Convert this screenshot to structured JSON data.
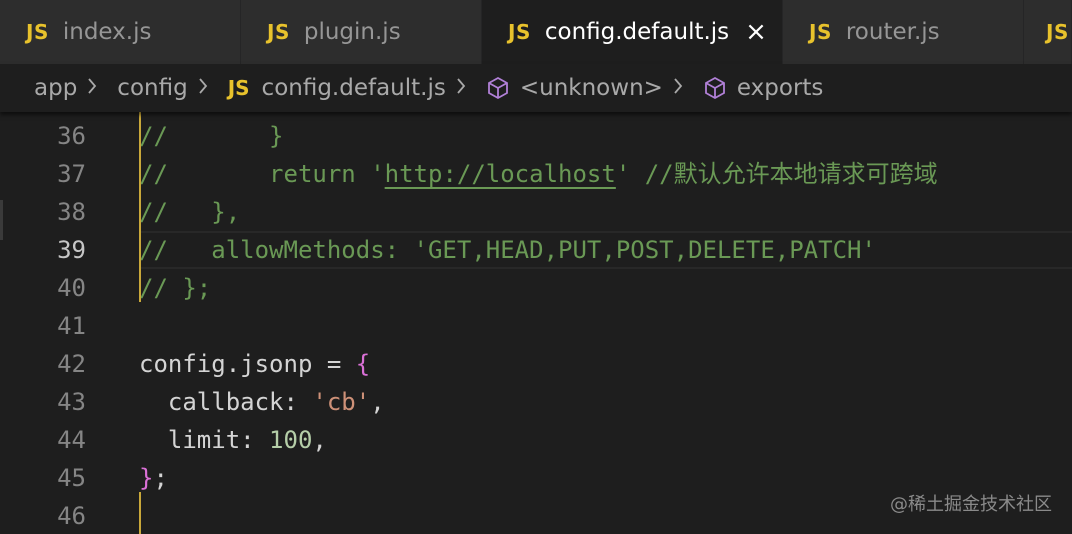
{
  "tabs": [
    {
      "lang": "JS",
      "label": "index.js",
      "active": false
    },
    {
      "lang": "JS",
      "label": "plugin.js",
      "active": false
    },
    {
      "lang": "JS",
      "label": "config.default.js",
      "active": true,
      "close": "×"
    },
    {
      "lang": "JS",
      "label": "router.js",
      "active": false
    },
    {
      "lang": "JS",
      "label": "",
      "active": false
    }
  ],
  "breadcrumb": {
    "app": "app",
    "config": "config",
    "file_lang": "JS",
    "file": "config.default.js",
    "unknown": "<unknown>",
    "exports": "exports",
    "separator": ">"
  },
  "editor": {
    "current_line": "39",
    "lines": [
      {
        "num": "36",
        "tokens": [
          {
            "t": "//       ",
            "c": "comment"
          },
          {
            "t": "}",
            "c": "comment"
          }
        ]
      },
      {
        "num": "37",
        "tokens": [
          {
            "t": "//       return '",
            "c": "comment"
          },
          {
            "t": "http://localhost",
            "c": "link"
          },
          {
            "t": "' //默认允许本地请求可跨域",
            "c": "comment"
          }
        ]
      },
      {
        "num": "38",
        "tokens": [
          {
            "t": "//   },",
            "c": "comment"
          }
        ]
      },
      {
        "num": "39",
        "tokens": [
          {
            "t": "//   allowMethods: 'GET,HEAD,PUT,POST,DELETE,PATCH'",
            "c": "comment"
          }
        ]
      },
      {
        "num": "40",
        "tokens": [
          {
            "t": "// };",
            "c": "comment"
          }
        ]
      },
      {
        "num": "41",
        "tokens": []
      },
      {
        "num": "42",
        "tokens": [
          {
            "t": "config.jsonp = ",
            "c": "plain"
          },
          {
            "t": "{",
            "c": "brace"
          }
        ]
      },
      {
        "num": "43",
        "tokens": [
          {
            "t": "  callback: ",
            "c": "plain"
          },
          {
            "t": "'cb'",
            "c": "str"
          },
          {
            "t": ",",
            "c": "plain"
          }
        ]
      },
      {
        "num": "44",
        "tokens": [
          {
            "t": "  limit: ",
            "c": "plain"
          },
          {
            "t": "100",
            "c": "num"
          },
          {
            "t": ",",
            "c": "plain"
          }
        ]
      },
      {
        "num": "45",
        "tokens": [
          {
            "t": "}",
            "c": "brace"
          },
          {
            "t": ";",
            "c": "plain"
          }
        ]
      },
      {
        "num": "46",
        "tokens": []
      }
    ]
  },
  "watermark": "@稀土掘金技术社区",
  "colors": {
    "js_badge": "#e8c22c",
    "comment": "#6a9955",
    "string": "#ce9178",
    "number": "#b5cea8",
    "brace": "#da70d6",
    "symbol_icon": "#b180d7"
  }
}
